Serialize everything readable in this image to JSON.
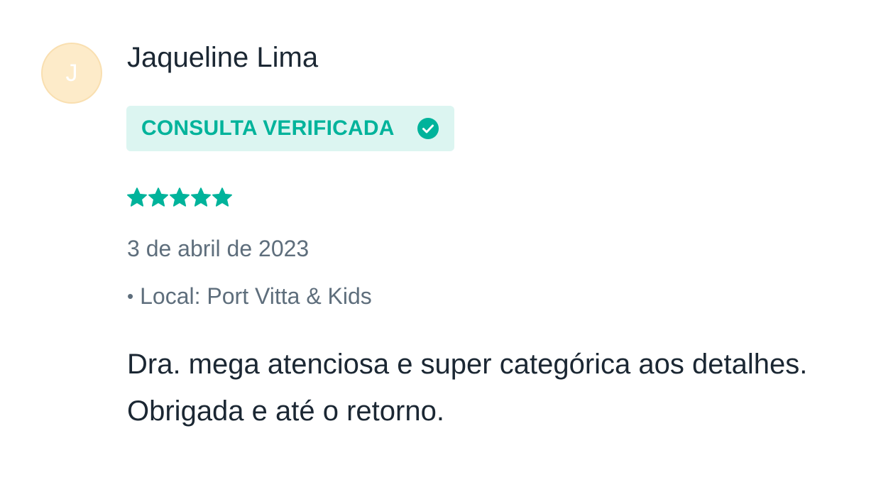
{
  "review": {
    "avatar_initial": "J",
    "author_name": "Jaqueline Lima",
    "badge_label": "CONSULTA VERIFICADA",
    "badge_icon": "check-circle-icon",
    "rating": 5,
    "rating_max": 5,
    "date": "3 de abril de 2023",
    "location_bullet": "•",
    "location": "Local: Port Vitta & Kids",
    "comment": "Dra. mega atenciosa e super categórica aos detalhes. Obrigada e até o retorno."
  },
  "colors": {
    "accent": "#00b39b",
    "badge_bg": "#dcf5f1",
    "avatar_bg": "#fdebc9",
    "text_primary": "#1b2733",
    "text_secondary": "#5e6e7c"
  }
}
